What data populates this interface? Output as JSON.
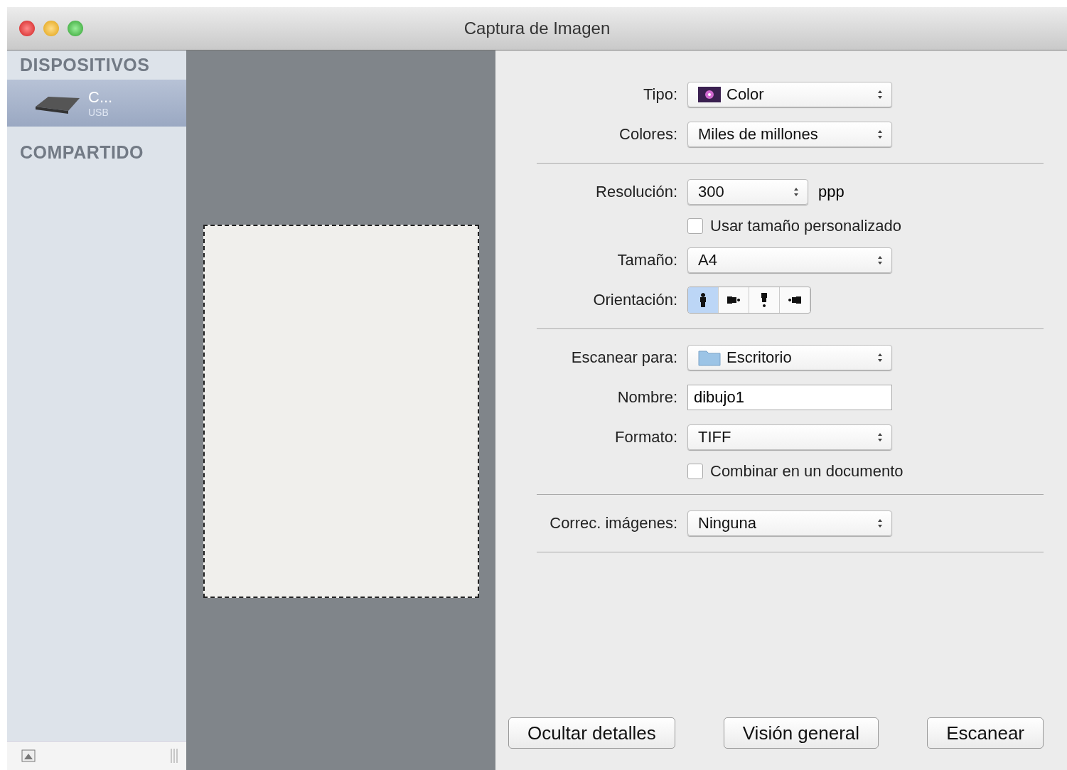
{
  "window": {
    "title": "Captura de Imagen"
  },
  "sidebar": {
    "sections": [
      {
        "heading": "DISPOSITIVOS",
        "items": [
          {
            "name": "C...",
            "subtitle": "USB",
            "selected": true
          }
        ]
      },
      {
        "heading": "COMPARTIDO"
      }
    ]
  },
  "form": [
    {
      "kind": "popup",
      "label": "Tipo:",
      "value": "Color"
    },
    {
      "kind": "popup",
      "label": "Colores:",
      "value": "Miles de millones"
    },
    {
      "kind": "separator"
    },
    {
      "kind": "popup",
      "label": "Resolución:",
      "value": "300",
      "unit": "ppp"
    },
    {
      "kind": "checkbox",
      "text": "Usar tamaño personalizado",
      "checked": false
    },
    {
      "kind": "popup",
      "label": "Tamaño:",
      "value": "A4"
    },
    {
      "kind": "segmented",
      "label": "Orientación:",
      "segments": [
        {
          "selected": true
        },
        {
          "selected": false
        },
        {
          "selected": false
        },
        {
          "selected": false
        }
      ]
    },
    {
      "kind": "separator"
    },
    {
      "kind": "popup",
      "label": "Escanear para:",
      "value": "Escritorio"
    },
    {
      "kind": "field",
      "label": "Nombre:",
      "value": "dibujo1"
    },
    {
      "kind": "popup",
      "label": "Formato:",
      "value": "TIFF"
    },
    {
      "kind": "checkbox",
      "text": "Combinar en un documento",
      "checked": false
    },
    {
      "kind": "separator"
    },
    {
      "kind": "popup",
      "label": "Correc. imágenes:",
      "value": "Ninguna"
    },
    {
      "kind": "separator"
    }
  ],
  "buttons": [
    "Ocultar detalles",
    "Visión general",
    "Escanear"
  ]
}
